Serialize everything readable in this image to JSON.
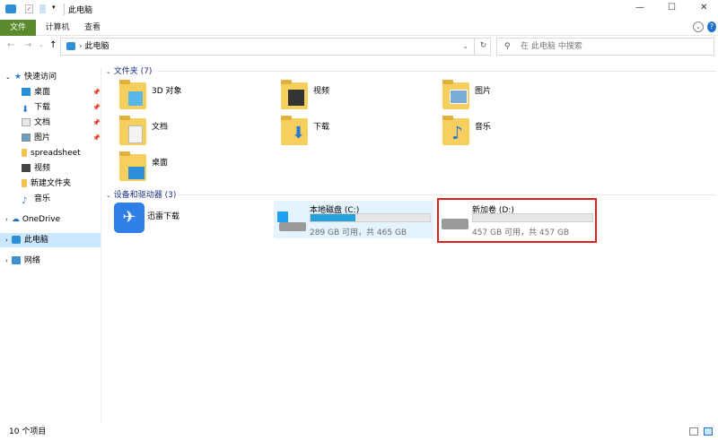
{
  "window": {
    "title": "此电脑",
    "controls": [
      "—",
      "☐",
      "✕"
    ]
  },
  "ribbon": {
    "tabs": [
      "文件",
      "计算机",
      "查看"
    ]
  },
  "address": {
    "path": "此电脑",
    "search_placeholder": "在 此电脑 中搜索"
  },
  "nav": {
    "quick_access": "快速访问",
    "items": [
      {
        "label": "桌面",
        "pinned": true
      },
      {
        "label": "下载",
        "pinned": true
      },
      {
        "label": "文档",
        "pinned": true
      },
      {
        "label": "图片",
        "pinned": true
      },
      {
        "label": "spreadsheet"
      },
      {
        "label": "视频"
      },
      {
        "label": "新建文件夹"
      },
      {
        "label": "音乐"
      }
    ],
    "onedrive": "OneDrive",
    "this_pc": "此电脑",
    "network": "网络"
  },
  "folders": {
    "header": "文件夹 (7)",
    "items": [
      "3D 对象",
      "视频",
      "图片",
      "文档",
      "下载",
      "音乐",
      "桌面"
    ]
  },
  "devices": {
    "header": "设备和驱动器 (3)",
    "app": "迅雷下载",
    "drives": [
      {
        "name": "本地磁盘 (C:)",
        "info": "289 GB 可用，共 465 GB",
        "used_fraction": 0.378
      },
      {
        "name": "新加卷 (D:)",
        "info": "457 GB 可用，共 457 GB",
        "used_fraction": 0.0
      }
    ]
  },
  "status": {
    "count": "10 个项目"
  },
  "colors": {
    "accent": "#26a0da",
    "highlight": "#e81123",
    "file_tab": "#5b8a2e"
  }
}
